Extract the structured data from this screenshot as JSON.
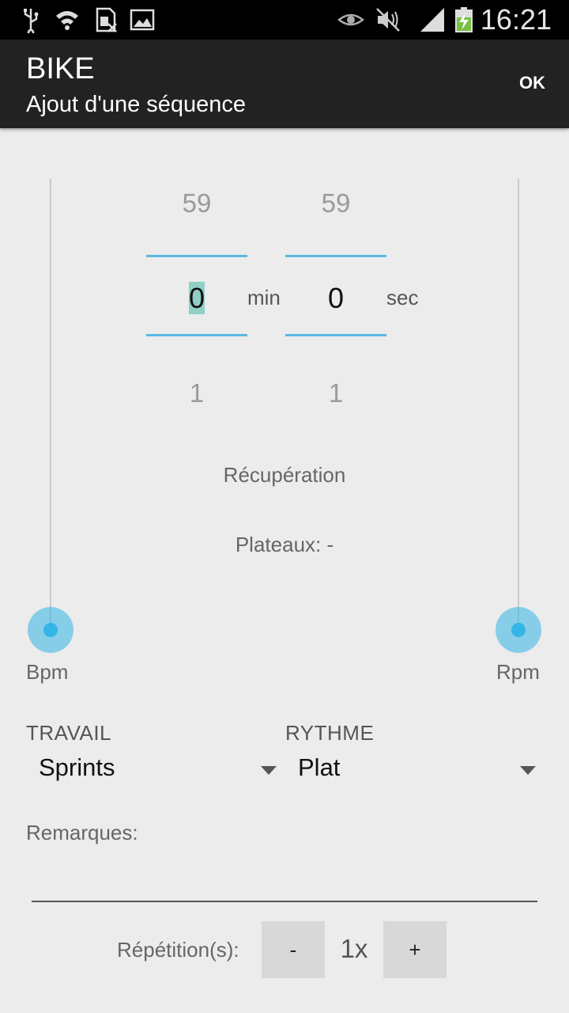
{
  "status_bar": {
    "time": "16:21",
    "icons": [
      "usb-icon",
      "wifi-icon",
      "sim-icon",
      "image-icon",
      "eye-icon",
      "mute-icon",
      "signal-icon",
      "battery-charging-icon"
    ]
  },
  "action_bar": {
    "title": "BIKE",
    "subtitle": "Ajout d'une séquence",
    "ok_label": "OK"
  },
  "minutes_picker": {
    "prev": "59",
    "current": "0",
    "next": "1",
    "unit": "min"
  },
  "seconds_picker": {
    "prev": "59",
    "current": "0",
    "next": "1",
    "unit": "sec"
  },
  "recovery_label": "Récupération",
  "plateaux_label": "Plateaux: -",
  "sliders": {
    "bpm": {
      "label": "Bpm",
      "value_fraction": 0.0
    },
    "rpm": {
      "label": "Rpm",
      "value_fraction": 0.0
    }
  },
  "travail": {
    "label": "TRAVAIL",
    "value": "Sprints"
  },
  "rythme": {
    "label": "RYTHME",
    "value": "Plat"
  },
  "remarks": {
    "label": "Remarques:",
    "value": ""
  },
  "repetition": {
    "label": "Répétition(s):",
    "minus": "-",
    "count": "1x",
    "plus": "+"
  },
  "colors": {
    "accent": "#33b5e5",
    "action_bar": "#222222",
    "background": "#ececec"
  }
}
